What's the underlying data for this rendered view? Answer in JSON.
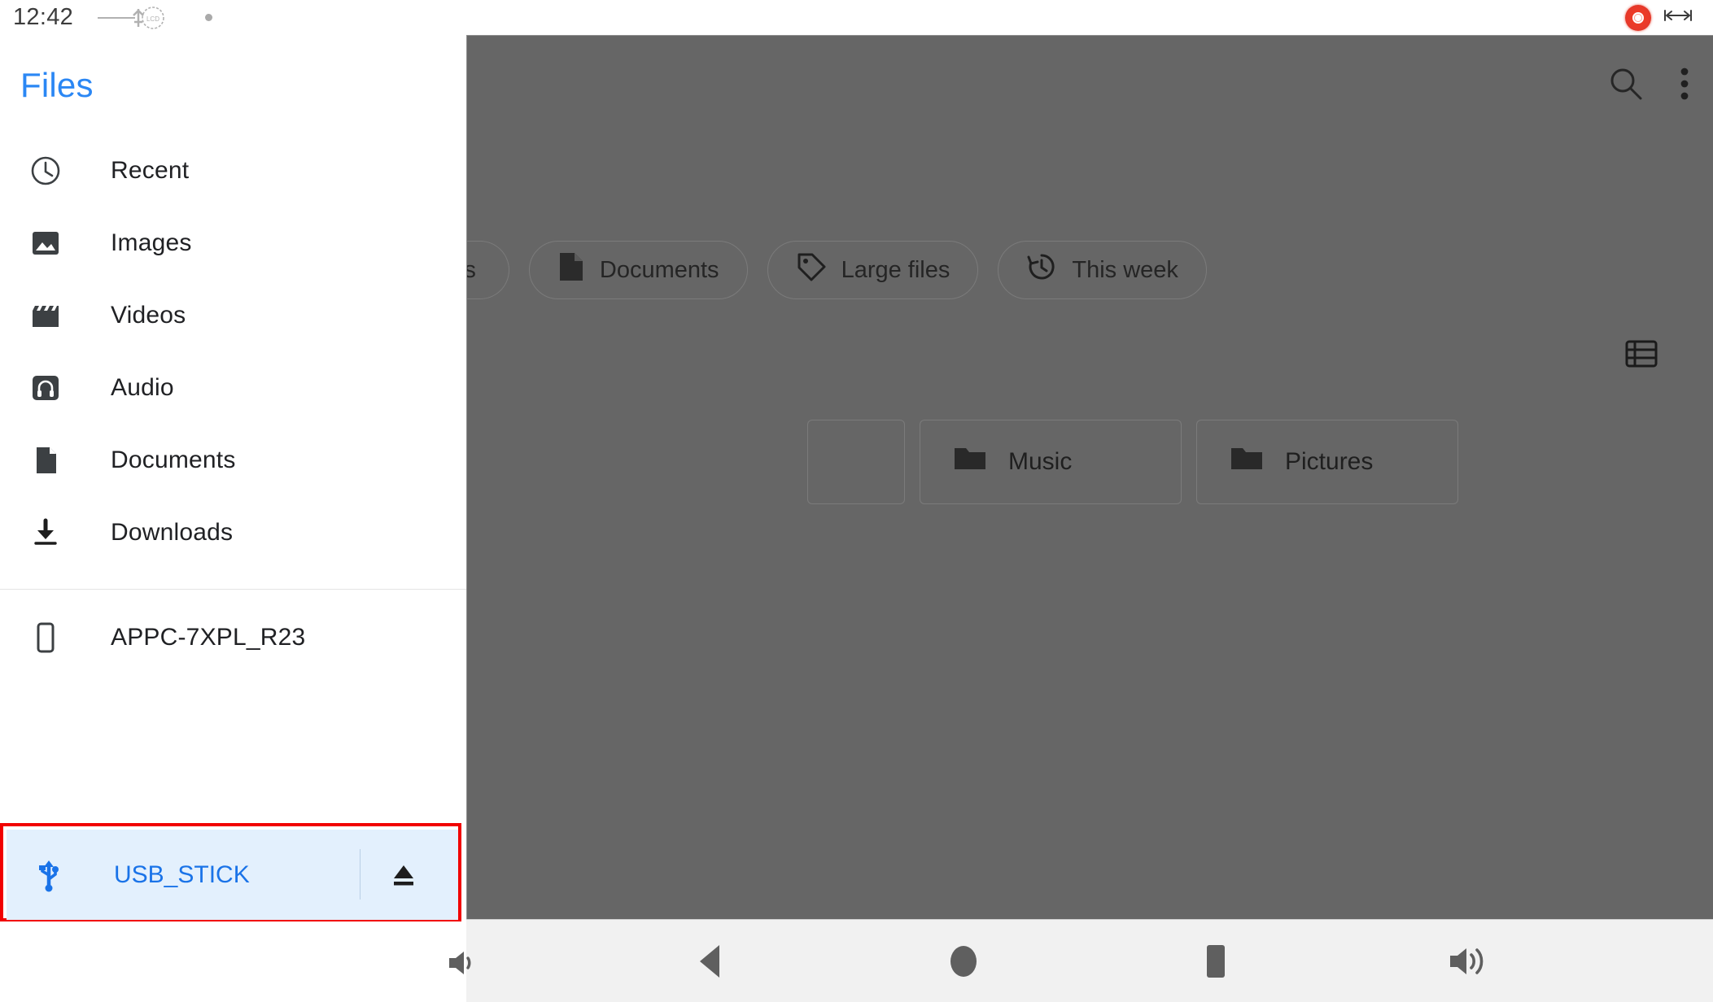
{
  "status_bar": {
    "clock": "12:42",
    "left_icons": [
      "usb-connection-icon",
      "lcd-badge-icon",
      "status-dot-icon"
    ],
    "right_icons": [
      "screen-recording-indicator-icon",
      "resize-horizontal-icon"
    ]
  },
  "drawer": {
    "title": "Files",
    "title_color": "#2b87f4",
    "sections": [
      {
        "name": "collections",
        "items": [
          {
            "label": "Recent",
            "icon": "clock-icon",
            "selected": false
          },
          {
            "label": "Images",
            "icon": "image-icon",
            "selected": false
          },
          {
            "label": "Videos",
            "icon": "clapper-icon",
            "selected": false
          },
          {
            "label": "Audio",
            "icon": "headphone-icon",
            "selected": false
          },
          {
            "label": "Documents",
            "icon": "document-icon",
            "selected": false
          },
          {
            "label": "Downloads",
            "icon": "download-icon",
            "selected": false
          }
        ]
      },
      {
        "name": "devices",
        "items": [
          {
            "label": "APPC-7XPL_R23",
            "icon": "phone-icon",
            "selected": false
          },
          {
            "label": "USB_STICK",
            "icon": "usb-icon",
            "selected": true,
            "eject_icon": "eject-icon"
          }
        ]
      }
    ],
    "selected_highlight_color": "#e3f0fd",
    "selected_text_color": "#1a73e8",
    "annotation_box_color": "#f10000"
  },
  "app_behind": {
    "scrim_color": "#666666",
    "top_actions": [
      {
        "label": "Search",
        "icon": "search-icon"
      },
      {
        "label": "More options",
        "icon": "overflow-menu-icon"
      }
    ],
    "view_toggle": {
      "label": "List view",
      "icon": "list-view-icon"
    },
    "filter_chips": [
      {
        "label": "deos",
        "icon": "",
        "clipped": true
      },
      {
        "label": "Documents",
        "icon": "document-icon",
        "clipped": false
      },
      {
        "label": "Large files",
        "icon": "tag-icon",
        "clipped": false
      },
      {
        "label": "This week",
        "icon": "history-icon",
        "clipped": false
      }
    ],
    "folder_cards": [
      {
        "label": "",
        "icon": "folder-icon",
        "clipped": true
      },
      {
        "label": "Music",
        "icon": "folder-icon",
        "clipped": false
      },
      {
        "label": "Pictures",
        "icon": "folder-icon",
        "clipped": false
      }
    ]
  },
  "system_nav": {
    "buttons": [
      {
        "label": "Back",
        "icon": "back-triangle-icon"
      },
      {
        "label": "Home",
        "icon": "home-circle-icon"
      },
      {
        "label": "Recent apps",
        "icon": "recents-square-icon"
      },
      {
        "label": "Volume up",
        "icon": "volume-up-icon"
      }
    ],
    "volume_down": {
      "label": "Volume down",
      "icon": "volume-down-icon"
    }
  }
}
